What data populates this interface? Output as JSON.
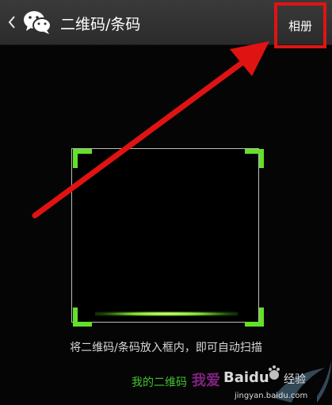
{
  "header": {
    "back_icon": "chevron-left-icon",
    "logo_icon": "wechat-logo-icon",
    "title": "二维码/条码",
    "album_button": "相册"
  },
  "scanner": {
    "hint": "将二维码/条码放入框内，即可自动扫描",
    "frame_color": "#63e12a"
  },
  "footer": {
    "my_qr_link": "我的二维码"
  },
  "watermark": {
    "brand_text": "我爱",
    "baidu_text": "Baidu",
    "jingyan_text": "经验",
    "url": "jingyan.baidu.com"
  },
  "annotation": {
    "color": "#e01313"
  }
}
